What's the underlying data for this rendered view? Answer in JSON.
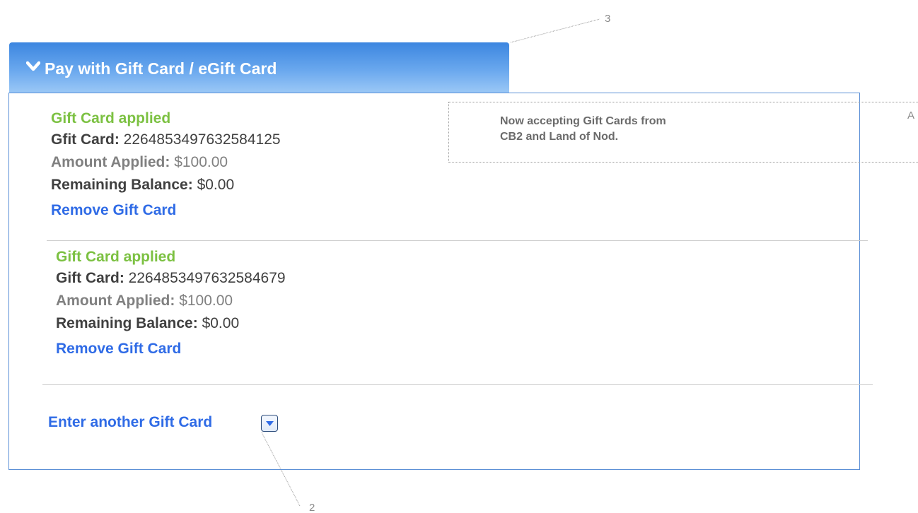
{
  "header": {
    "title": "Pay with Gift Card / eGift Card",
    "icon": "chevron-down-icon"
  },
  "cards": [
    {
      "status": "Gift Card applied",
      "card_label": "Gfit Card:",
      "card_number": "2264853497632584125",
      "amount_label": "Amount Applied:",
      "amount_value": "$100.00",
      "balance_label": "Remaining Balance:",
      "balance_value": "$0.00",
      "remove_label": "Remove Gift Card"
    },
    {
      "status": "Gift Card applied",
      "card_label": "Gift Card:",
      "card_number": "2264853497632584679",
      "amount_label": "Amount Applied:",
      "amount_value": "$100.00",
      "balance_label": "Remaining Balance:",
      "balance_value": "$0.00",
      "remove_label": "Remove Gift Card"
    }
  ],
  "enter_another": {
    "label": "Enter another Gift Card",
    "icon": "dropdown-arrow-icon"
  },
  "notice": {
    "line1": "Now accepting Gift Cards from",
    "line2": "CB2 and Land of Nod."
  },
  "annotations": {
    "a": "A",
    "three": "3",
    "two": "2"
  },
  "colors": {
    "accent_blue": "#2f6be6",
    "applied_green": "#7cc142",
    "header_blue": "#3c86e0"
  }
}
